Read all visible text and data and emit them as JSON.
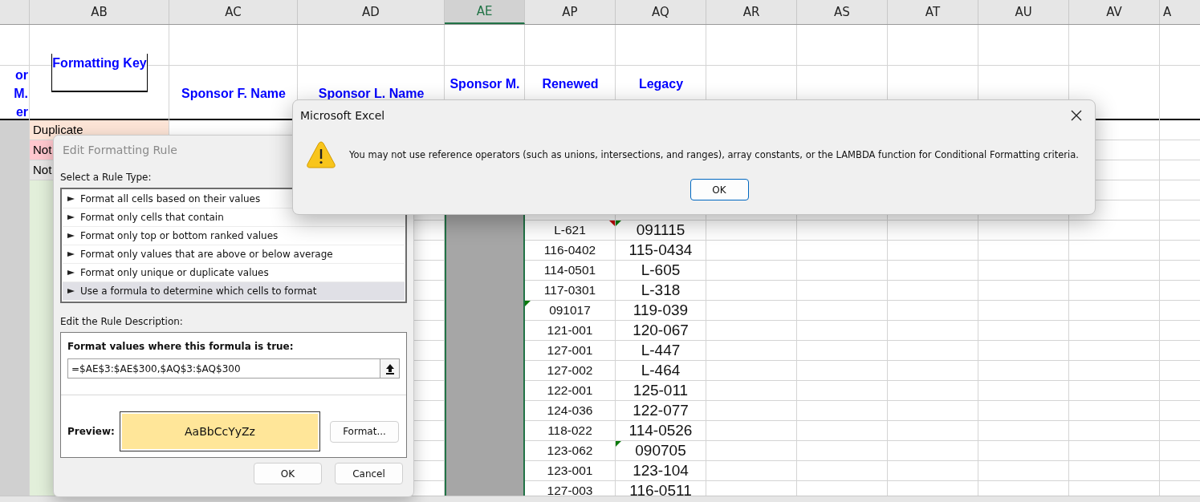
{
  "sheet": {
    "columns": [
      {
        "label": "AB",
        "selected": false
      },
      {
        "label": "AC",
        "selected": false
      },
      {
        "label": "AD",
        "selected": false
      },
      {
        "label": "AE",
        "selected": true
      },
      {
        "label": "AP",
        "selected": false
      },
      {
        "label": "AQ",
        "selected": false
      },
      {
        "label": "AR",
        "selected": false
      },
      {
        "label": "AS",
        "selected": false
      },
      {
        "label": "AT",
        "selected": false
      },
      {
        "label": "AU",
        "selected": false
      },
      {
        "label": "AV",
        "selected": false
      },
      {
        "label": "A",
        "selected": false
      }
    ],
    "headers": [
      "or M.\ner",
      "Formatting Key",
      "Sponsor F. Name",
      "Sponsor L. Name",
      "Sponsor M.",
      "Renewed",
      "Legacy"
    ],
    "key_cells": [
      {
        "text": "Duplicate",
        "color": "#fce4d6"
      },
      {
        "text": "Not",
        "color": "#ffc7ce"
      },
      {
        "text": "Not",
        "color": "#e7e6e6"
      }
    ],
    "rows": [
      {
        "cells": [
          {
            "text": "L-621",
            "error": false,
            "comment": true
          },
          {
            "text": "091115",
            "error": true,
            "comment": false
          }
        ]
      },
      {
        "cells": [
          {
            "text": "116-0402",
            "error": false,
            "comment": false
          },
          {
            "text": "115-0434",
            "error": false,
            "comment": false
          }
        ]
      },
      {
        "cells": [
          {
            "text": "114-0501",
            "error": false,
            "comment": false
          },
          {
            "text": "L-605",
            "error": false,
            "comment": false
          }
        ]
      },
      {
        "cells": [
          {
            "text": "117-0301",
            "error": false,
            "comment": false
          },
          {
            "text": "L-318",
            "error": false,
            "comment": false
          }
        ]
      },
      {
        "cells": [
          {
            "text": "091017",
            "error": true,
            "comment": false
          },
          {
            "text": "119-039",
            "error": false,
            "comment": false
          }
        ]
      },
      {
        "cells": [
          {
            "text": "121-001",
            "error": false,
            "comment": false
          },
          {
            "text": "120-067",
            "error": false,
            "comment": false
          }
        ]
      },
      {
        "cells": [
          {
            "text": "127-001",
            "error": false,
            "comment": false
          },
          {
            "text": "L-447",
            "error": false,
            "comment": false
          }
        ]
      },
      {
        "cells": [
          {
            "text": "127-002",
            "error": false,
            "comment": false
          },
          {
            "text": "L-464",
            "error": false,
            "comment": false
          }
        ]
      },
      {
        "cells": [
          {
            "text": "122-001",
            "error": false,
            "comment": false
          },
          {
            "text": "125-011",
            "error": false,
            "comment": false
          }
        ]
      },
      {
        "cells": [
          {
            "text": "124-036",
            "error": false,
            "comment": false
          },
          {
            "text": "122-077",
            "error": false,
            "comment": false
          }
        ]
      },
      {
        "cells": [
          {
            "text": "118-022",
            "error": false,
            "comment": false
          },
          {
            "text": "114-0526",
            "error": false,
            "comment": false
          }
        ]
      },
      {
        "cells": [
          {
            "text": "123-062",
            "error": false,
            "comment": false
          },
          {
            "text": "090705",
            "error": true,
            "comment": false
          }
        ]
      },
      {
        "cells": [
          {
            "text": "123-001",
            "error": false,
            "comment": false
          },
          {
            "text": "123-104",
            "error": false,
            "comment": false
          }
        ]
      },
      {
        "cells": [
          {
            "text": "127-003",
            "error": false,
            "comment": false
          },
          {
            "text": "116-0511",
            "error": false,
            "comment": false
          }
        ]
      }
    ]
  },
  "rule_dialog": {
    "title": "Edit Formatting Rule",
    "select_label": "Select a Rule Type:",
    "rule_types": [
      {
        "label": "Format all cells based on their values",
        "selected": false
      },
      {
        "label": "Format only cells that contain",
        "selected": false
      },
      {
        "label": "Format only top or bottom ranked values",
        "selected": false
      },
      {
        "label": "Format only values that are above or below average",
        "selected": false
      },
      {
        "label": "Format only unique or duplicate values",
        "selected": false
      },
      {
        "label": "Use a formula to determine which cells to format",
        "selected": true
      }
    ],
    "description_label": "Edit the Rule Description:",
    "formula_label": "Format values where this formula is true:",
    "formula": "=$AE$3:$AE$300,$AQ$3:$AQ$300",
    "preview_label": "Preview:",
    "preview": {
      "text": "AaBbCcYyZz"
    },
    "format_button": "Format...",
    "buttons": [
      "OK",
      "Cancel"
    ]
  },
  "message_box": {
    "title": "Microsoft Excel",
    "message": "You may not use reference operators (such as unions, intersections, and ranges), array constants, or the LAMBDA function for Conditional Formatting criteria.",
    "button": "OK"
  }
}
